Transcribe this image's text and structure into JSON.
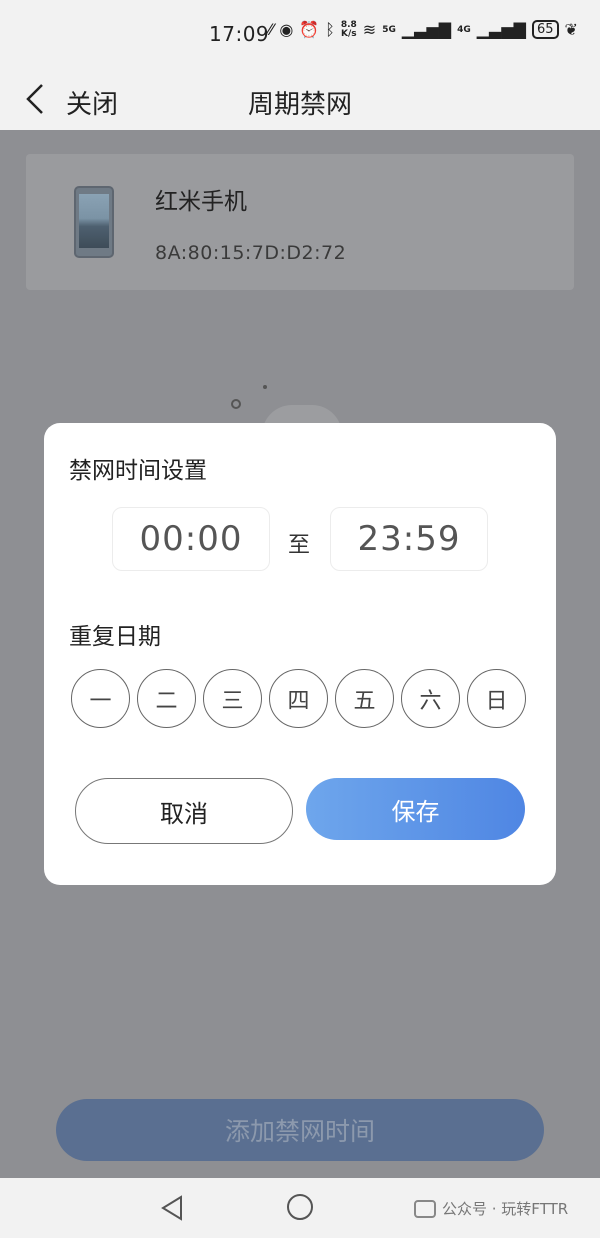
{
  "status_bar": {
    "time": "17:09",
    "net_speed_top": "8.8",
    "net_speed_bottom": "K/s",
    "signal_5g": "5G",
    "signal_4g": "4G",
    "battery": "65"
  },
  "nav": {
    "close_label": "关闭",
    "title": "周期禁网"
  },
  "device": {
    "name": "红米手机",
    "mac": "8A:80:15:7D:D2:72"
  },
  "dialog": {
    "title": "禁网时间设置",
    "start_time": "00:00",
    "to_label": "至",
    "end_time": "23:59",
    "repeat_label": "重复日期",
    "days": [
      "一",
      "二",
      "三",
      "四",
      "五",
      "六",
      "日"
    ],
    "cancel_label": "取消",
    "save_label": "保存"
  },
  "add_button_label": "添加禁网时间",
  "watermark": "公众号 · 玩转FTTR"
}
